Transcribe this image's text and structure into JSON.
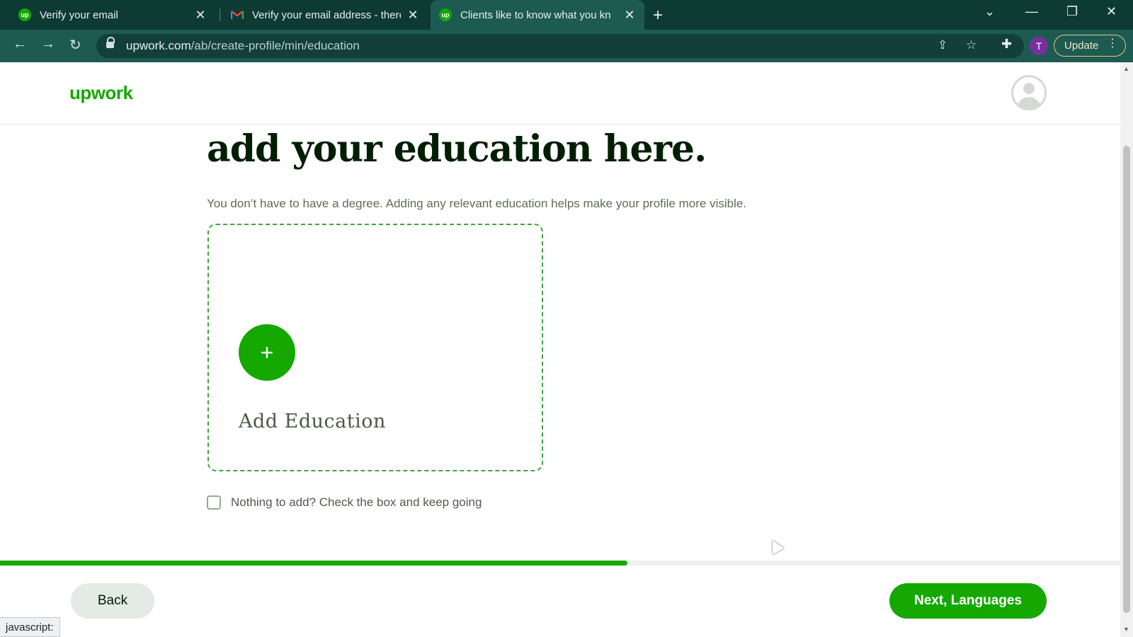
{
  "browser": {
    "tabs": [
      {
        "title": "Verify your email",
        "favicon": "upwork-favicon",
        "active": false
      },
      {
        "title": "Verify your email address - there",
        "favicon": "gmail-favicon",
        "active": false
      },
      {
        "title": "Clients like to know what you kn",
        "favicon": "upwork-favicon",
        "active": true
      }
    ],
    "url_domain": "upwork.com",
    "url_path": "/ab/create-profile/min/education",
    "profile_initial": "T",
    "update_label": "Update",
    "status_text": "javascript:"
  },
  "site": {
    "logo": "upwork",
    "brand_color": "#14a800"
  },
  "main": {
    "heading": "add your education here.",
    "subtext": "You don’t have to have a degree. Adding any relevant education helps make your profile more visible.",
    "add_card_label": "Add Education",
    "skip_checkbox_label": "Nothing to add? Check the box and keep going",
    "skip_checked": false
  },
  "footer": {
    "progress_percent": 56,
    "back_label": "Back",
    "next_label": "Next, Languages"
  }
}
